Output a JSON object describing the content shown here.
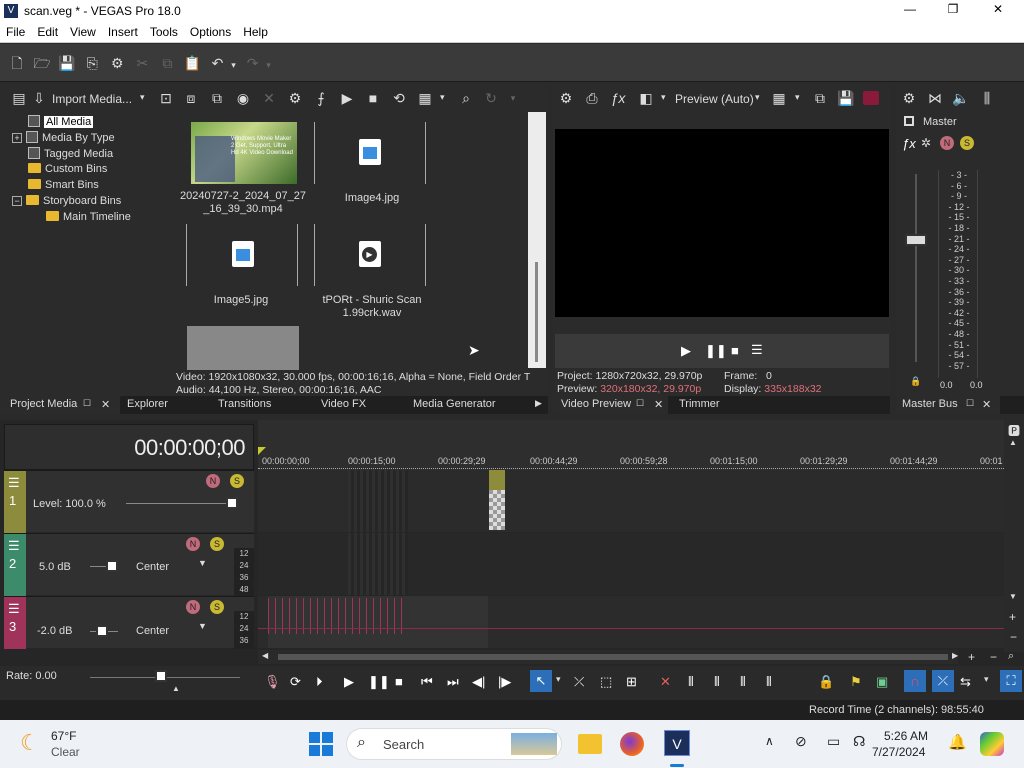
{
  "window": {
    "title": "scan.veg * - VEGAS Pro 18.0",
    "app_icon": "V",
    "min": "—",
    "max": "❐",
    "close": "✕"
  },
  "menu": [
    "File",
    "Edit",
    "View",
    "Insert",
    "Tools",
    "Options",
    "Help"
  ],
  "media_toolbar": {
    "import_label": "Import Media..."
  },
  "tree": [
    {
      "label": "All Media",
      "selected": true,
      "expander": ""
    },
    {
      "label": "Media By Type",
      "expander": "+"
    },
    {
      "label": "Tagged Media",
      "expander": ""
    },
    {
      "label": "Custom Bins",
      "expander": ""
    },
    {
      "label": "Smart Bins",
      "expander": ""
    },
    {
      "label": "Storyboard Bins",
      "expander": "−"
    },
    {
      "label": "Main Timeline",
      "expander": ""
    }
  ],
  "media_items": [
    {
      "name": "20240727-2_2024_07_27_16_39_30.mp4",
      "line1": "20240727-2_2024_07_27",
      "line2": "_16_39_30.mp4",
      "thumb_text": "Windows Movie Maker 2 Get, Support, Ultra Hd 4K Video Download"
    },
    {
      "name": "Image4.jpg",
      "line1": "Image4.jpg",
      "line2": ""
    },
    {
      "name": "Image5.jpg",
      "line1": "Image5.jpg",
      "line2": ""
    },
    {
      "name": "tPORt - Shuric Scan 1.99crk.wav",
      "line1": "tPORt - Shuric Scan",
      "line2": "1.99crk.wav"
    }
  ],
  "media_info": {
    "video": "Video: 1920x1080x32, 30.000 fps, 00:00:16;16, Alpha = None, Field Order T",
    "audio": "Audio: 44,100 Hz, Stereo, 00:00:16;16, AAC"
  },
  "left_tabs": [
    "Project Media",
    "Explorer",
    "Transitions",
    "Video FX",
    "Media Generator"
  ],
  "preview": {
    "mode": "Preview (Auto)",
    "project_label": "Project:",
    "project_value": "1280x720x32, 29.970p",
    "preview_label": "Preview:",
    "preview_value": "320x180x32, 29.970p",
    "frame_label": "Frame:",
    "frame_value": "0",
    "display_label": "Display:",
    "display_value": "335x188x32"
  },
  "preview_tabs": [
    "Video Preview",
    "Trimmer"
  ],
  "master": {
    "title": "Master",
    "scale": [
      "3",
      "6",
      "9",
      "12",
      "15",
      "18",
      "21",
      "24",
      "27",
      "30",
      "33",
      "36",
      "39",
      "42",
      "45",
      "48",
      "51",
      "54",
      "57"
    ],
    "left_value": "0.0",
    "right_value": "0.0",
    "tab": "Master Bus"
  },
  "timeline": {
    "timecode": "00:00:00;00",
    "ruler": [
      "00:00:00;00",
      "00:00:15;00",
      "00:00:29;29",
      "00:00:44;29",
      "00:00:59;28",
      "00:01:15;00",
      "00:01:29;29",
      "00:01:44;29",
      "00:01"
    ],
    "rate": "Rate: 0.00"
  },
  "tracks": [
    {
      "num": "1",
      "level": "Level: 100.0 %",
      "color": "#8c8c3c"
    },
    {
      "num": "2",
      "level": "5.0 dB",
      "pan": "Center",
      "color": "#3c8c6c",
      "meter": [
        "12",
        "24",
        "36",
        "48"
      ]
    },
    {
      "num": "3",
      "level": "-2.0 dB",
      "pan": "Center",
      "color": "#a0335a",
      "meter": [
        "12",
        "24",
        "36"
      ]
    }
  ],
  "status": {
    "record_time": "Record Time (2 channels): 98:55:40"
  },
  "taskbar": {
    "weather_temp": "67°F",
    "weather_desc": "Clear",
    "search": "Search",
    "time": "5:26 AM",
    "date": "7/27/2024"
  }
}
